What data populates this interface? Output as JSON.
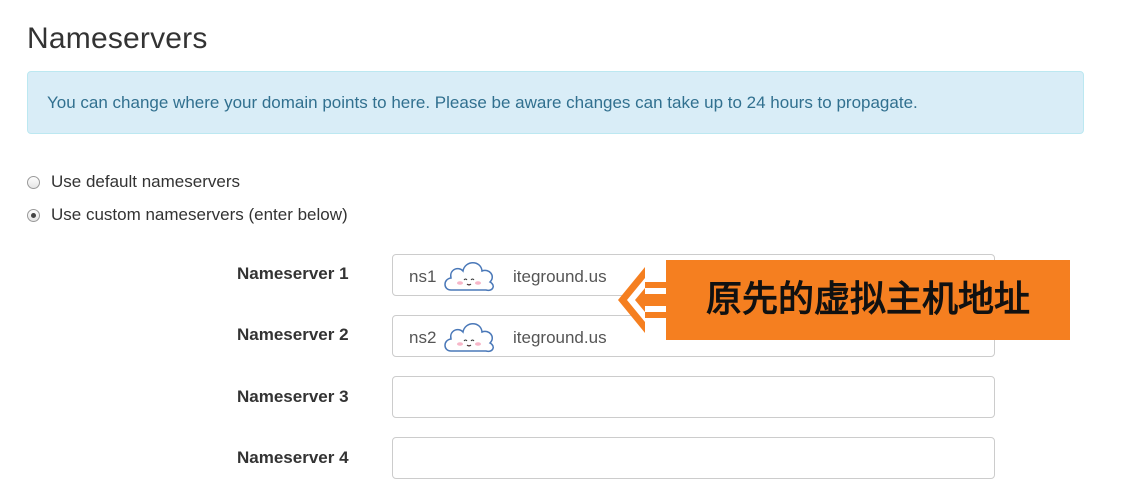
{
  "page": {
    "title": "Nameservers"
  },
  "alert": {
    "text": "You can change where your domain points to here. Please be aware changes can take up to 24 hours to propagate."
  },
  "options": [
    {
      "label": "Use default nameservers",
      "checked": false
    },
    {
      "label": "Use custom nameservers (enter below)",
      "checked": true
    }
  ],
  "nameservers": [
    {
      "label": "Nameserver 1",
      "value": "ns1.siteground.us",
      "display_prefix": "ns1",
      "display_suffix": "iteground.us"
    },
    {
      "label": "Nameserver 2",
      "value": "ns2.siteground.us",
      "display_prefix": "ns2",
      "display_suffix": "iteground.us"
    },
    {
      "label": "Nameserver 3",
      "value": ""
    },
    {
      "label": "Nameserver 4",
      "value": ""
    }
  ],
  "annotation": {
    "text": "原先的虚拟主机地址",
    "color": "#f57f20",
    "icon": "left-arrow-icon"
  },
  "watermark": {
    "icon": "cloud-sticker-icon"
  }
}
